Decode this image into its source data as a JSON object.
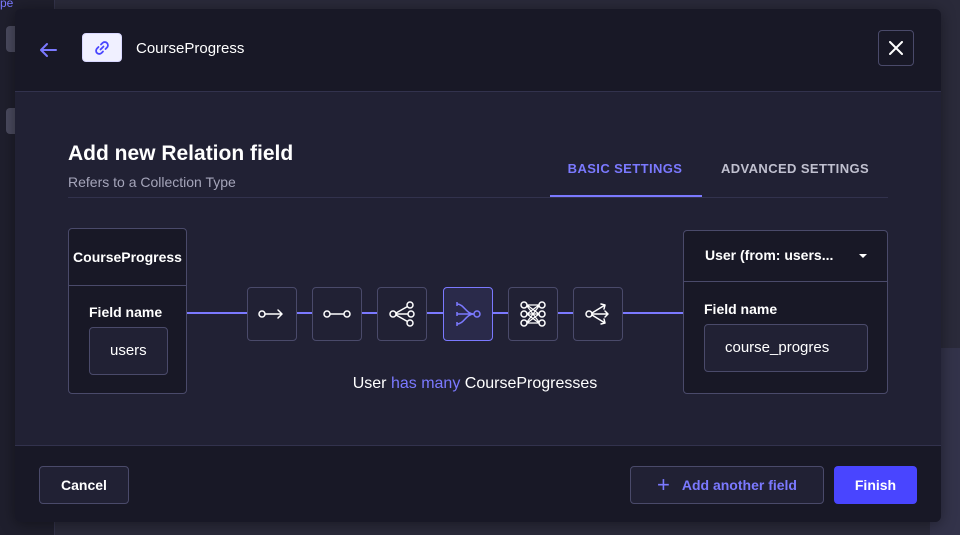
{
  "background": {
    "link_fragment": "pe"
  },
  "header": {
    "title": "CourseProgress",
    "back_icon": "arrow-left-icon",
    "type_icon": "link-icon",
    "close_icon": "close-icon"
  },
  "main": {
    "title": "Add new Relation field",
    "subtitle": "Refers to a Collection Type",
    "tabs": [
      {
        "label": "BASIC SETTINGS",
        "active": true
      },
      {
        "label": "ADVANCED SETTINGS",
        "active": false
      }
    ]
  },
  "left_box": {
    "collection": "CourseProgress",
    "field_label": "Field name",
    "field_value": "users"
  },
  "relations": [
    {
      "icon": "one-way-icon"
    },
    {
      "icon": "one-to-one-icon"
    },
    {
      "icon": "one-to-many-icon"
    },
    {
      "icon": "many-to-one-icon",
      "selected": true
    },
    {
      "icon": "many-to-many-icon"
    },
    {
      "icon": "many-way-icon"
    }
  ],
  "relation_text": {
    "left": "User",
    "middle": "has many",
    "right": "CourseProgresses"
  },
  "right_box": {
    "selected_target": "User (from: users...",
    "field_label": "Field name",
    "field_value": "course_progres"
  },
  "footer": {
    "cancel": "Cancel",
    "add_another": "Add another field",
    "finish": "Finish"
  },
  "colors": {
    "accent": "#7b79ff",
    "primary": "#4945ff",
    "surface": "#212134",
    "header": "#181826"
  }
}
